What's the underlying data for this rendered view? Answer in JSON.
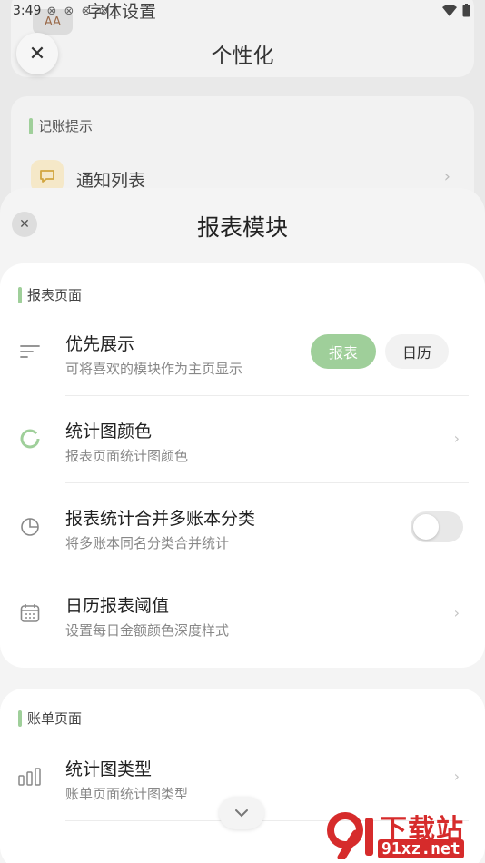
{
  "status_bar": {
    "time": "3:49"
  },
  "background": {
    "font_setting_label": "字体设置",
    "font_icon_text": "AA",
    "header_title": "个性化",
    "reminder_section_label": "记账提示",
    "notification_list_label": "通知列表"
  },
  "sheet": {
    "title": "报表模块",
    "report_section": {
      "label": "报表页面",
      "rows": [
        {
          "title": "优先展示",
          "subtitle": "可将喜欢的模块作为主页显示",
          "options": [
            "报表",
            "日历"
          ],
          "selected": "报表"
        },
        {
          "title": "统计图颜色",
          "subtitle": "报表页面统计图颜色"
        },
        {
          "title": "报表统计合并多账本分类",
          "subtitle": "将多账本同名分类合并统计",
          "toggle_on": false
        },
        {
          "title": "日历报表阈值",
          "subtitle": "设置每日金额颜色深度样式"
        }
      ]
    },
    "bill_section": {
      "label": "账单页面",
      "rows": [
        {
          "title": "统计图类型",
          "subtitle": "账单页面统计图类型"
        }
      ]
    }
  },
  "watermark": {
    "text": "下载站",
    "url": "91xz.net"
  },
  "colors": {
    "accent": "#9fcf9a",
    "watermark": "#d62b2b"
  }
}
